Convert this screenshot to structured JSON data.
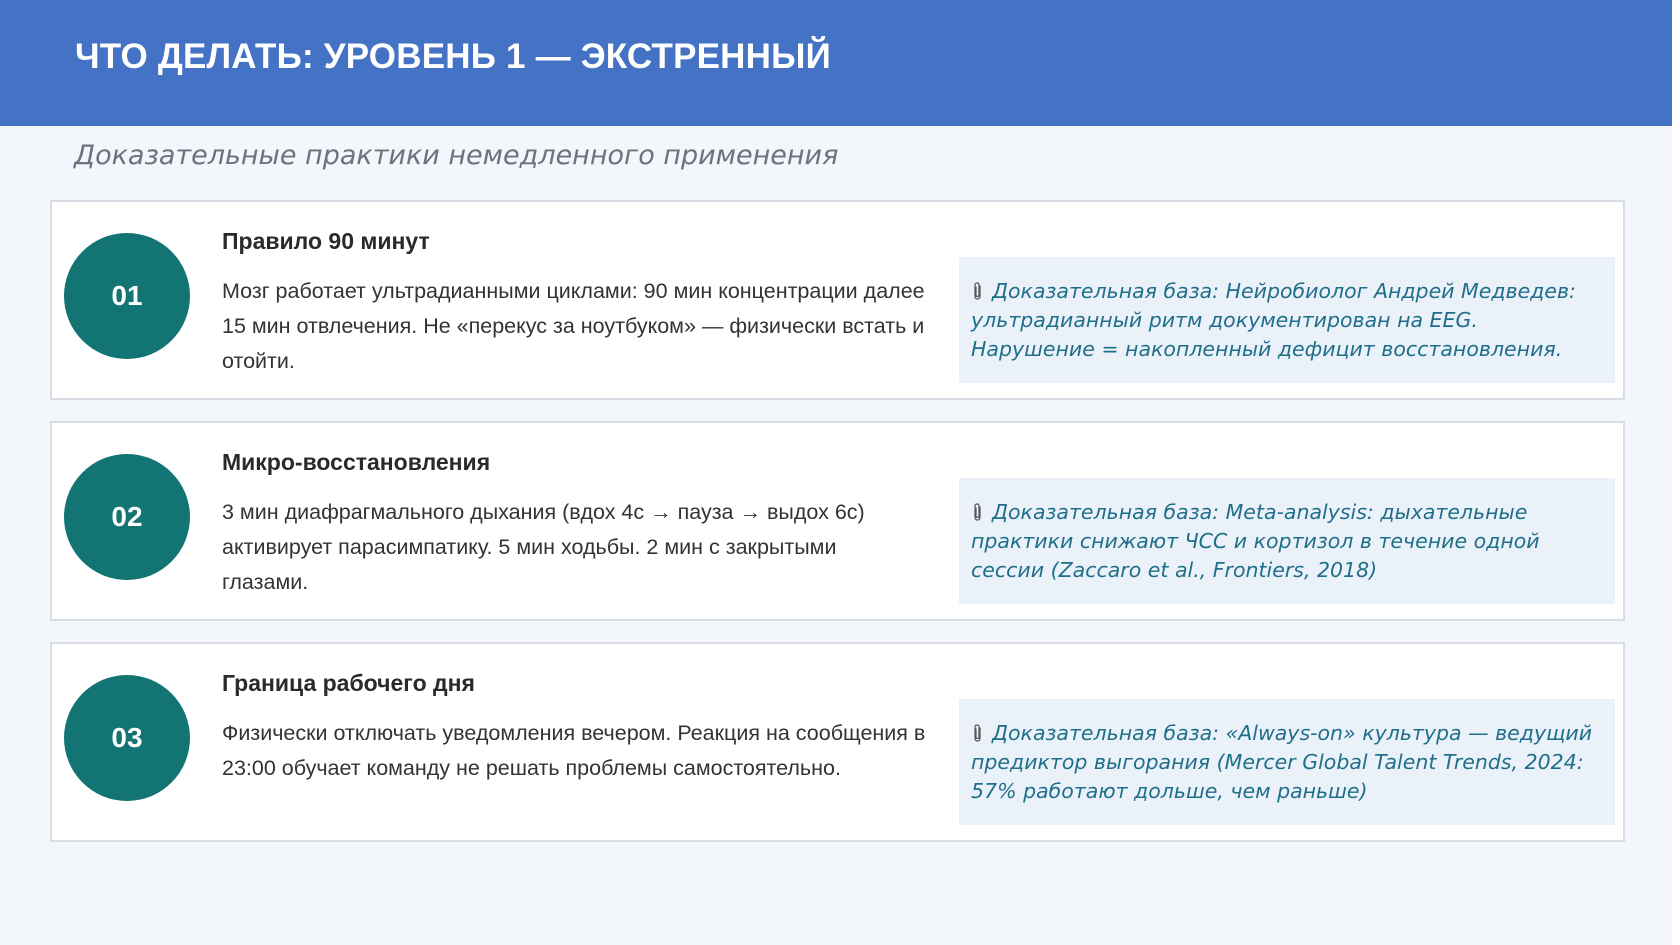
{
  "header": {
    "title": "ЧТО ДЕЛАТЬ: УРОВЕНЬ 1 — ЭКСТРЕННЫЙ"
  },
  "subtitle": "Доказательные практики немедленного применения",
  "colors": {
    "header_bg": "#4472c4",
    "badge": "#137474",
    "evidence_bg": "#ebf1f9",
    "evidence_text": "#1f6f8b"
  },
  "cards": [
    {
      "number": "01",
      "title": "Правило 90 минут",
      "body": "Мозг работает ультрадианными циклами: 90 мин концентрации далее 15 мин отвлечения. Не «перекус за ноутбуком» — физически встать и отойти.",
      "evidence_icon": "paperclip-icon",
      "evidence": "Доказательная база: Нейробиолог Андрей Медведев: ультрадианный ритм документирован на EEG. Нарушение = накопленный дефицит восстановления."
    },
    {
      "number": "02",
      "title": "Микро-восстановления",
      "body": "3 мин диафрагмального дыхания (вдох 4с → пауза → выдох 6с) активирует парасимпатику. 5 мин ходьбы. 2 мин с закрытыми глазами.",
      "evidence_icon": "paperclip-icon",
      "evidence": "Доказательная база: Meta-analysis: дыхательные практики снижают ЧСС и кортизол в течение одной сессии (Zaccaro et al., Frontiers, 2018)"
    },
    {
      "number": "03",
      "title": "Граница рабочего дня",
      "body": "Физически отключать уведомления вечером. Реакция на сообщения в 23:00 обучает команду не решать проблемы самостоятельно.",
      "evidence_icon": "paperclip-icon",
      "evidence": "Доказательная база: «Always-on» культура — ведущий предиктор выгорания (Mercer Global Talent Trends, 2024: 57% работают дольше, чем раньше)"
    }
  ]
}
